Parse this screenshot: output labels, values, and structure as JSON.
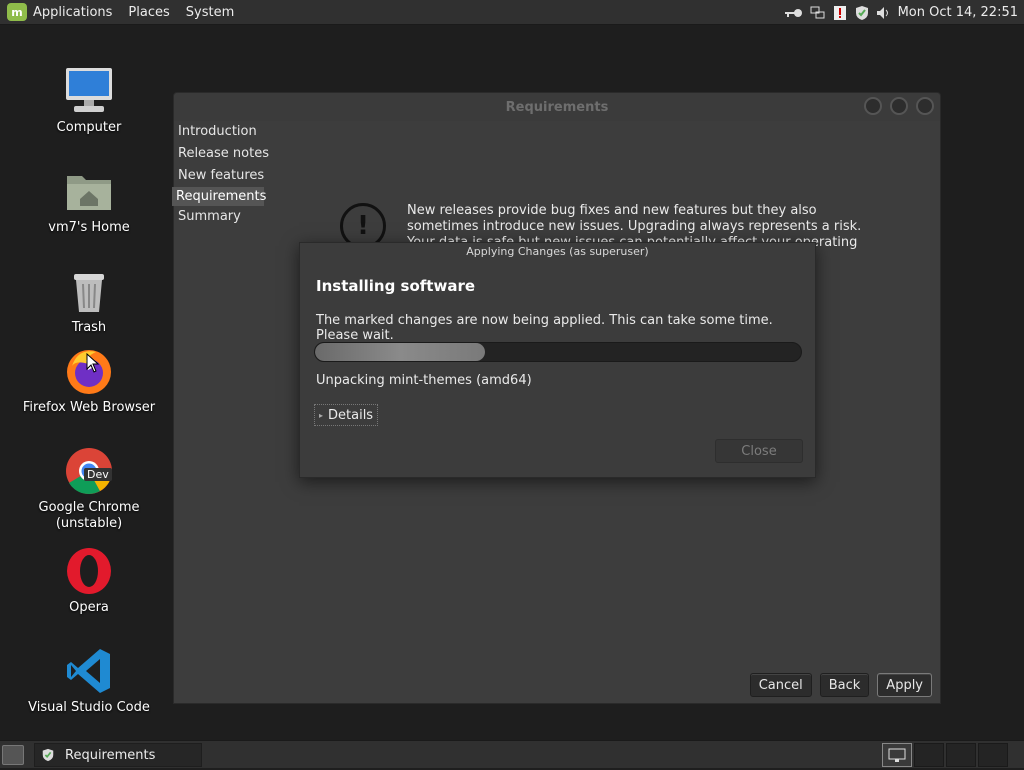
{
  "top_panel": {
    "menus": [
      "Applications",
      "Places",
      "System"
    ],
    "clock": "Mon Oct 14, 22:51"
  },
  "desktop_icons": [
    {
      "label": "Computer",
      "icon": "computer-icon"
    },
    {
      "label": "vm7's Home",
      "icon": "home-folder-icon"
    },
    {
      "label": "Trash",
      "icon": "trash-icon"
    },
    {
      "label": "Firefox Web Browser",
      "icon": "firefox-icon"
    },
    {
      "label": "Google Chrome\n(unstable)",
      "icon": "chrome-dev-icon",
      "badge": "Dev"
    },
    {
      "label": "Opera",
      "icon": "opera-icon"
    },
    {
      "label": "Visual Studio Code",
      "icon": "vscode-icon"
    }
  ],
  "main_window": {
    "title": "Requirements",
    "sidebar": [
      "Introduction",
      "Release notes",
      "New features",
      "Requirements",
      "Summary"
    ],
    "active_index": 3,
    "warning_text": "New releases provide bug fixes and new features but they also sometimes introduce new issues. Upgrading always represents a risk. Your data is safe but new issues can potentially affect your operating system.",
    "buttons": {
      "cancel": "Cancel",
      "back": "Back",
      "apply": "Apply"
    }
  },
  "dialog": {
    "title": "Applying Changes (as superuser)",
    "heading": "Installing software",
    "message": "The marked changes are now being applied. This can take some time. Please wait.",
    "progress": 0.35,
    "status": "Unpacking mint-themes (amd64)",
    "details_label": "Details",
    "close_label": "Close"
  },
  "taskbar": {
    "window_title": "Requirements"
  },
  "colors": {
    "panel": "#303030",
    "window_bg": "#3d3d3d",
    "mint_green": "#8fbc4a"
  }
}
